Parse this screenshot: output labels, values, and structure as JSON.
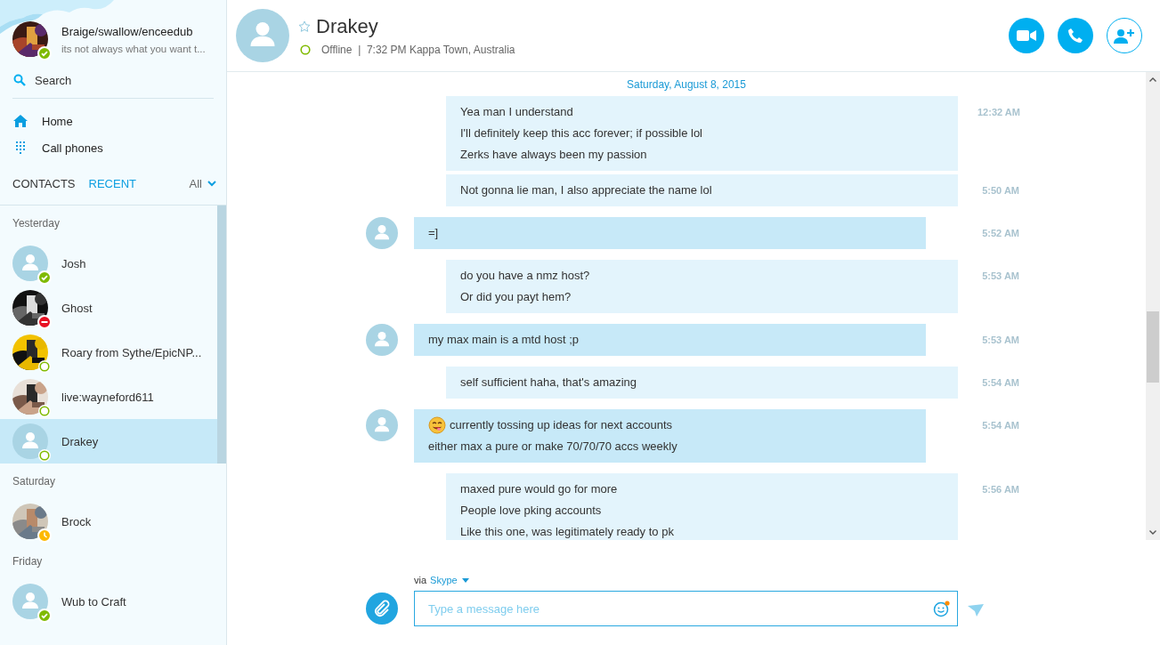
{
  "profile": {
    "name": "Braige/swallow/enceedub",
    "mood": "its not always what you want t...",
    "status": {
      "kind": "online"
    }
  },
  "search": {
    "label": "Search"
  },
  "nav": [
    {
      "kind": "home",
      "label": "Home"
    },
    {
      "kind": "dialpad",
      "label": "Call phones"
    }
  ],
  "tabs": [
    {
      "label": "CONTACTS",
      "selected": false
    },
    {
      "label": "RECENT",
      "selected": true
    }
  ],
  "filter": {
    "label": "All"
  },
  "contact_groups": [
    {
      "heading": "Yesterday",
      "contacts": [
        {
          "name": "Josh",
          "kind": "default",
          "status": {
            "kind": "online"
          },
          "selected": false
        },
        {
          "name": "Ghost",
          "status": {
            "kind": "busy"
          },
          "selected": false
        },
        {
          "name": "Roary from Sythe/EpicNP...",
          "status": {
            "kind": "offline"
          },
          "selected": false
        },
        {
          "name": "live:wayneford611",
          "status": {
            "kind": "offline"
          },
          "selected": false
        },
        {
          "name": "Drakey",
          "kind": "default",
          "status": {
            "kind": "offline"
          },
          "selected": true
        }
      ]
    },
    {
      "heading": "Saturday",
      "contacts": [
        {
          "name": "Brock",
          "status": {
            "kind": "away"
          },
          "selected": false
        }
      ]
    },
    {
      "heading": "Friday",
      "contacts": [
        {
          "name": "Wub to Craft",
          "kind": "default",
          "status": {
            "kind": "online"
          },
          "selected": false
        }
      ]
    }
  ],
  "conversation": {
    "name": "Drakey",
    "favorite": false,
    "status": {
      "kind": "offline"
    },
    "status_line": "Offline  |  7:32 PM Kappa Town, Australia"
  },
  "actions": [
    {
      "kind": "video"
    },
    {
      "kind": "call"
    },
    {
      "kind": "add-contact"
    }
  ],
  "date_separator": "Saturday, August 8, 2015",
  "messages": [
    {
      "kind": "outgoing",
      "lines": [
        "Yea man I understand",
        "I'll definitely keep this acc forever; if possible lol",
        "Zerks have always been my passion"
      ],
      "time": "12:32 AM"
    },
    {
      "kind": "outgoing",
      "lines": [
        "Not gonna lie man, I also appreciate the name lol"
      ],
      "time": "5:50 AM"
    },
    {
      "kind": "incoming",
      "lines": [
        "=]"
      ],
      "time": "5:52 AM"
    },
    {
      "kind": "outgoing",
      "lines": [
        "do you have a nmz host?",
        "Or did  you payt hem?"
      ],
      "time": "5:53 AM"
    },
    {
      "kind": "incoming",
      "lines": [
        "my max main is a mtd host ;p"
      ],
      "time": "5:53 AM"
    },
    {
      "kind": "outgoing",
      "lines": [
        "self sufficient haha, that's amazing"
      ],
      "time": "5:54 AM"
    },
    {
      "kind": "incoming",
      "emoji": true,
      "lines": [
        "currently tossing up ideas for next accounts",
        "either max a pure or make 70/70/70 accs weekly"
      ],
      "time": "5:54 AM"
    },
    {
      "kind": "outgoing",
      "lines": [
        "maxed pure would go for more",
        "People love pking accounts",
        "Like this one, was legitimately ready to pk"
      ],
      "time": "5:56 AM"
    }
  ],
  "compose": {
    "via": "via",
    "service": "Skype",
    "placeholder": "Type a message here"
  }
}
